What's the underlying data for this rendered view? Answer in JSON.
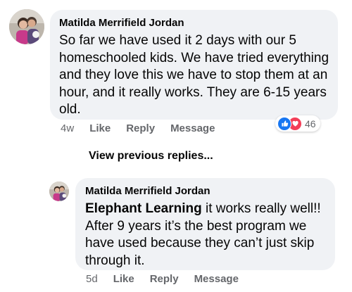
{
  "comment": {
    "author": "Matilda Merrifield Jordan",
    "text": "So far we have used it 2 days with our 5 homeschooled kids.  We have tried everything and they love this we have to stop them at an hour, and it really works. They are 6-15 years old.",
    "time": "4w",
    "like_label": "Like",
    "reply_label": "Reply",
    "message_label": "Message",
    "reactions": {
      "icons": [
        "like-icon",
        "love-icon"
      ],
      "count": "46"
    }
  },
  "view_previous_label": "View previous replies...",
  "reply": {
    "author": "Matilda Merrifield Jordan",
    "mention": "Elephant Learning",
    "text": " it works really well!! After 9 years it’s the best program we have used because they can’t just skip through it.",
    "time": "5d",
    "like_label": "Like",
    "reply_label": "Reply",
    "message_label": "Message"
  },
  "colors": {
    "bubble": "#f0f2f5",
    "secondary_text": "#65676b",
    "like_blue": "#1877f2",
    "love_red": "#f33e58"
  }
}
